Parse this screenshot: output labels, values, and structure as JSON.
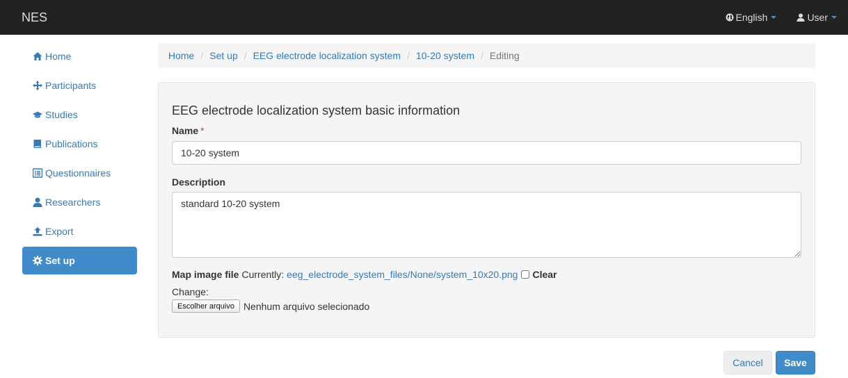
{
  "navbar": {
    "brand": "NES",
    "language": {
      "label": "English",
      "icon": "globe-icon"
    },
    "user": {
      "label": "User",
      "icon": "user-icon"
    }
  },
  "sidebar": {
    "items": [
      {
        "label": "Home",
        "icon": "home-icon",
        "active": false
      },
      {
        "label": "Participants",
        "icon": "move-icon",
        "active": false
      },
      {
        "label": "Studies",
        "icon": "education-icon",
        "active": false
      },
      {
        "label": "Publications",
        "icon": "book-icon",
        "active": false
      },
      {
        "label": "Questionnaires",
        "icon": "list-alt-icon",
        "active": false
      },
      {
        "label": "Researchers",
        "icon": "user-icon",
        "active": false
      },
      {
        "label": "Export",
        "icon": "export-icon",
        "active": false
      },
      {
        "label": "Set up",
        "icon": "cog-icon",
        "active": true
      }
    ]
  },
  "breadcrumb": [
    {
      "label": "Home",
      "link": true
    },
    {
      "label": "Set up",
      "link": true
    },
    {
      "label": "EEG electrode localization system",
      "link": true
    },
    {
      "label": "10-20 system",
      "link": true
    },
    {
      "label": "Editing",
      "link": false
    }
  ],
  "form": {
    "title": "EEG electrode localization system basic information",
    "name_label": "Name",
    "required_mark": "*",
    "name_value": "10-20 system",
    "description_label": "Description",
    "description_value": "standard 10-20 system",
    "map_label": "Map image file",
    "currently_label": "Currently:",
    "current_file": "eeg_electrode_system_files/None/system_10x20.png",
    "clear_label": "Clear",
    "clear_checked": false,
    "change_label": "Change:",
    "file_button": "Escolher arquivo",
    "no_file_text": "Nenhum arquivo selecionado"
  },
  "actions": {
    "cancel": "Cancel",
    "save": "Save"
  },
  "colors": {
    "navbar": "#222222",
    "link": "#337ab7",
    "primary": "#428bca",
    "panel": "#f5f5f5"
  }
}
